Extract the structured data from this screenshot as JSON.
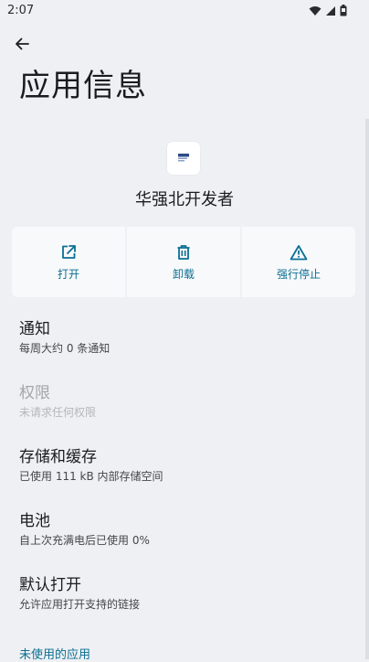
{
  "status_bar": {
    "time": "2:07",
    "icons": [
      "wifi-icon",
      "cellular-signal-icon",
      "battery-icon"
    ]
  },
  "header": {
    "title": "应用信息"
  },
  "app": {
    "name": "华强北开发者",
    "icon": "app-icon"
  },
  "actions": [
    {
      "label": "打开",
      "icon": "open-external-icon"
    },
    {
      "label": "卸载",
      "icon": "trash-icon"
    },
    {
      "label": "强行停止",
      "icon": "warning-icon"
    }
  ],
  "settings": [
    {
      "title": "通知",
      "subtitle": "每周大约 0 条通知",
      "enabled": true
    },
    {
      "title": "权限",
      "subtitle": "未请求任何权限",
      "enabled": false
    },
    {
      "title": "存储和缓存",
      "subtitle": "已使用 111 kB 内部存储空间",
      "enabled": true
    },
    {
      "title": "电池",
      "subtitle": "自上次充满电后已使用 0%",
      "enabled": true
    },
    {
      "title": "默认打开",
      "subtitle": "允许应用打开支持的链接",
      "enabled": true
    }
  ],
  "footer": {
    "section_label": "未使用的应用"
  },
  "colors": {
    "background": "#eef0f3",
    "card": "#f8f9fb",
    "accent": "#0b6f93",
    "text_primary": "#1b1c1e",
    "text_disabled": "#a3a6aa"
  }
}
